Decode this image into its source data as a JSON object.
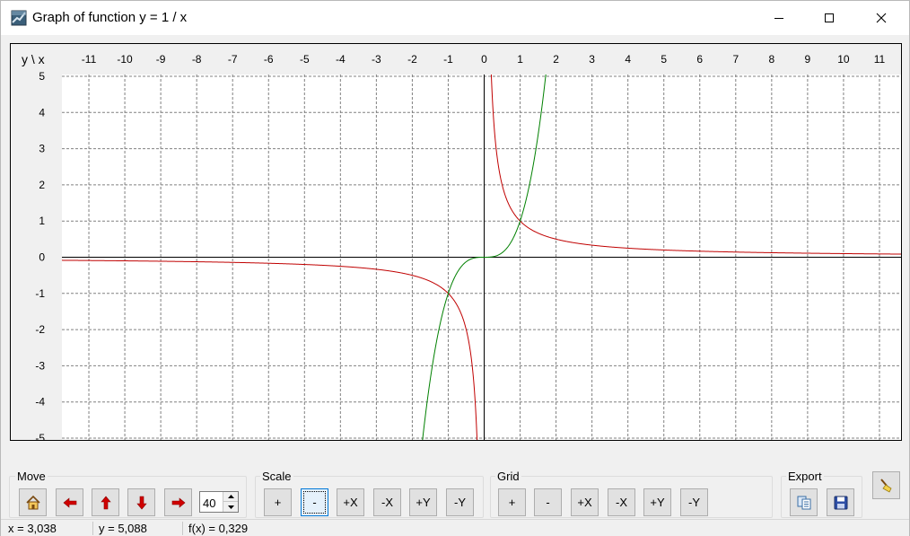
{
  "window": {
    "title": "Graph of function y = 1 / x",
    "icon": "graph-app-icon"
  },
  "graph": {
    "corner_label": "y \\ x",
    "functions": [
      {
        "expr": "1/x",
        "color": "#c00000"
      },
      {
        "expr": "x^3",
        "color": "#008000"
      }
    ],
    "axis_color": "#000000",
    "grid_color": "#808080",
    "background": "#ffffff",
    "xlim": [
      -11.75,
      11.6
    ],
    "ylim": [
      -5.05,
      5.05
    ]
  },
  "chart_data": {
    "type": "line",
    "title": "Graph of function y = 1 / x",
    "xlabel": "x",
    "ylabel": "y",
    "x_ticks": [
      -11,
      -10,
      -9,
      -8,
      -7,
      -6,
      -5,
      -4,
      -3,
      -2,
      -1,
      0,
      1,
      2,
      3,
      4,
      5,
      6,
      7,
      8,
      9,
      10,
      11
    ],
    "y_ticks": [
      5,
      4,
      3,
      2,
      1,
      0,
      -1,
      -2,
      -3,
      -4,
      -5
    ],
    "xlim": [
      -11.75,
      11.6
    ],
    "ylim": [
      -5.05,
      5.05
    ],
    "grid": true,
    "series": [
      {
        "expr": "y = 1/x",
        "color": "#c00000"
      },
      {
        "expr": "y = x^3",
        "color": "#008000"
      }
    ]
  },
  "toolbar": {
    "move": {
      "title": "Move",
      "home_icon": "home-icon",
      "left_icon": "arrow-left-icon",
      "up_icon": "arrow-up-icon",
      "down_icon": "arrow-down-icon",
      "right_icon": "arrow-right-icon",
      "step_value": "40"
    },
    "scale": {
      "title": "Scale",
      "buttons": [
        "+",
        "-",
        "+X",
        "-X",
        "+Y",
        "-Y"
      ]
    },
    "grid": {
      "title": "Grid",
      "buttons": [
        "+",
        "-",
        "+X",
        "-X",
        "+Y",
        "-Y"
      ]
    },
    "export": {
      "title": "Export",
      "copy_icon": "copy-icon",
      "save_icon": "save-icon"
    },
    "clear_icon": "broom-icon"
  },
  "status": {
    "x": "x = 3,038",
    "y": "y = 5,088",
    "fx": "f(x) = 0,329"
  }
}
